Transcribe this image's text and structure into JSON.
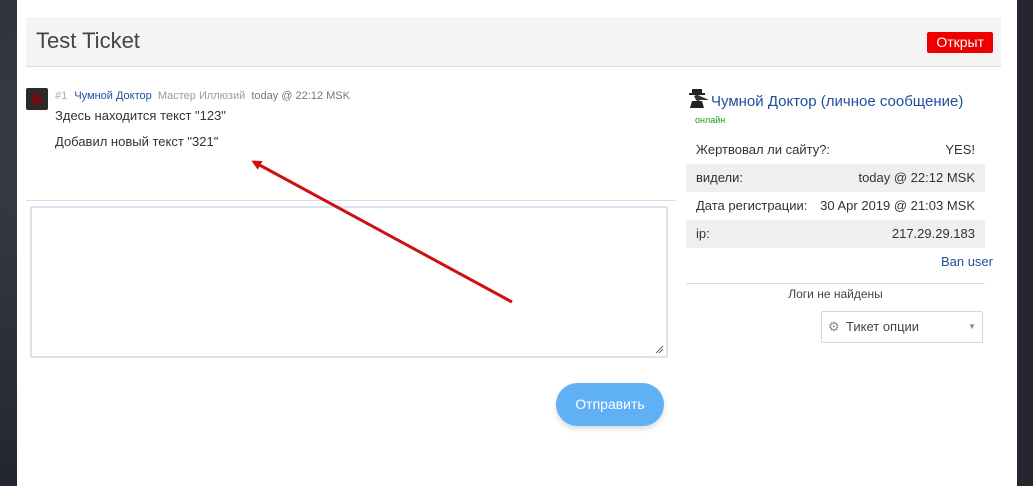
{
  "ticket": {
    "title": "Test Ticket",
    "status": "Открыт"
  },
  "message": {
    "number": "#1",
    "author": "Чумной Доктор",
    "rank": "Мастер Иллюзий",
    "time": "today @ 22:12 MSK",
    "lines": [
      "Здесь находится текст \"123\"",
      "Добавил новый текст \"321\""
    ]
  },
  "reply": {
    "value": "",
    "send_label": "Отправить"
  },
  "sidebar": {
    "user_name": "Чумной Доктор",
    "pm_label": "личное сообщение",
    "online_label": "онлайн",
    "rows": [
      {
        "key": "Жертвовал ли сайту?:",
        "value": "YES!"
      },
      {
        "key": "видели:",
        "value": "today @ 22:12 MSK"
      },
      {
        "key": "Дата регистрации:",
        "value": "30 Apr 2019 @ 21:03 MSK"
      },
      {
        "key": "ip:",
        "value": "217.29.29.183"
      }
    ],
    "ban_label": "Ban user",
    "no_logs": "Логи не найдены",
    "options_label": "Тикет опции",
    "options_icon": "gear-icon"
  },
  "colors": {
    "status_bg": "#ee0000",
    "link": "#1d4f9c",
    "send_bg": "#5fb0f4",
    "online": "#1e9a1e",
    "annotation_arrow": "#cc1111"
  }
}
